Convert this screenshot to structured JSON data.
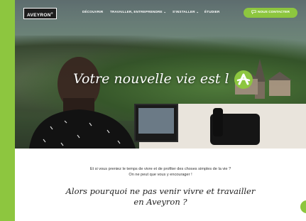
{
  "header": {
    "logo": "AVEYRON",
    "nav": [
      {
        "label": "DÉCOUVRIR"
      },
      {
        "label": "TRAVAILLER, ENTREPRENDRE ⌄"
      },
      {
        "label": "S'INSTALLER ⌄"
      },
      {
        "label": "ÉTUDIER"
      }
    ],
    "contact_label": "NOUS CONTACTER"
  },
  "hero": {
    "title": "Votre nouvelle vie est l"
  },
  "intro": {
    "line1": "Et si vous preniez le temps de vivre et de profiter des choses simples de la vie ?",
    "line2": "On ne peut que vous y encourager !"
  },
  "headline": {
    "line1": "Alors pourquoi ne pas venir vivre et travailler",
    "line2": "en Aveyron ?"
  },
  "colors": {
    "accent": "#8dc63f",
    "logo_bg": "#1d1d1d"
  }
}
